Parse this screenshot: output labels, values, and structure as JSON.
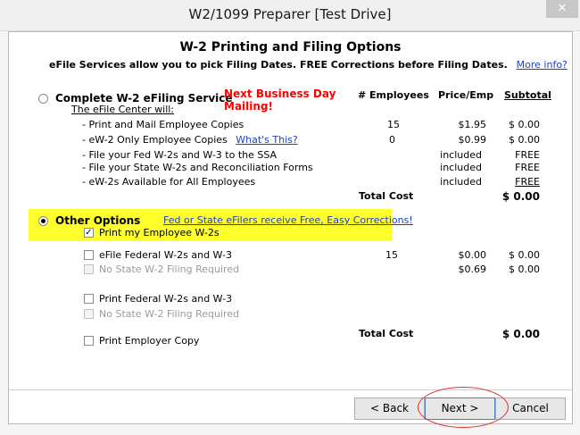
{
  "window": {
    "title": "W2/1099 Preparer [Test Drive]",
    "close_glyph": "✕"
  },
  "header": {
    "title": "W-2 Printing and Filing Options",
    "subtitle": "eFile Services allow you to pick Filing Dates. FREE Corrections before Filing Dates.",
    "more_info": "More info?"
  },
  "columns": {
    "employees": "# Employees",
    "price": "Price/Emp",
    "subtotal": "Subtotal"
  },
  "efile_service": {
    "label": "Complete W-2 eFiling Service",
    "promo_line1": "Next Business Day",
    "promo_line2": "Mailing!",
    "center_label": "The eFile Center will:",
    "rows": [
      {
        "label": "- Print and Mail Employee Copies",
        "employees": "15",
        "price": "$1.95",
        "subtotal": "$ 0.00"
      },
      {
        "label": "- eW-2 Only Employee Copies",
        "link": "What's This?",
        "employees": "0",
        "price": "$0.99",
        "subtotal": "$ 0.00"
      },
      {
        "label": "- File your Fed W-2s and W-3 to the SSA",
        "price": "included",
        "subtotal": "FREE"
      },
      {
        "label": "- File your State W-2s and Reconciliation Forms",
        "price": "included",
        "subtotal": "FREE"
      },
      {
        "label": "- eW-2s Available for All Employees",
        "price": "included",
        "subtotal": "FREE"
      }
    ],
    "total_label": "Total Cost",
    "total_value": "$ 0.00"
  },
  "other_options": {
    "label": "Other Options",
    "promo_link": "Fed or State eFilers receive Free, Easy Corrections!",
    "print_employee": "Print my Employee W-2s",
    "efile_federal": {
      "label": "eFile Federal W-2s and W-3",
      "employees": "15",
      "price": "$0.00",
      "subtotal": "$ 0.00"
    },
    "no_state_1": {
      "label": "No State W-2 Filing Required",
      "price": "$0.69",
      "subtotal": "$ 0.00"
    },
    "print_federal": "Print Federal W-2s and W-3",
    "no_state_2": "No State W-2 Filing Required",
    "print_employer": "Print Employer Copy",
    "total_label": "Total Cost",
    "total_value": "$ 0.00"
  },
  "buttons": {
    "back": "< Back",
    "next": "Next >",
    "cancel": "Cancel"
  },
  "colors": {
    "highlight": "#ffff2b",
    "promo_red": "#ff0000",
    "link_blue": "#1f3fbf",
    "annotation_red": "#e03030"
  }
}
